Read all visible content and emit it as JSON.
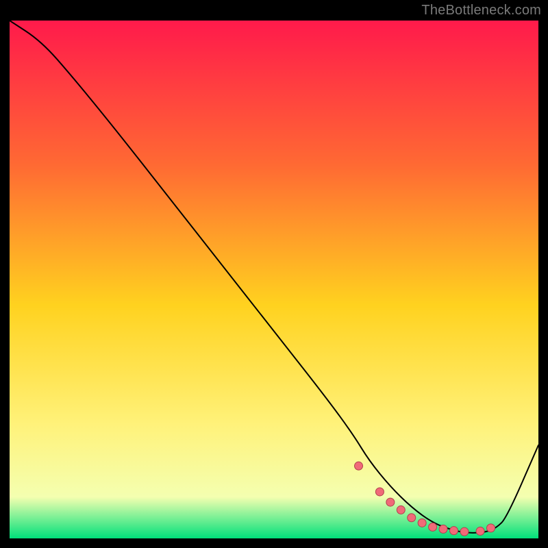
{
  "attribution": "TheBottleneck.com",
  "colors": {
    "bg": "#000000",
    "grad_top": "#ff1a4b",
    "grad_upper": "#ff6a33",
    "grad_mid": "#ffd21f",
    "grad_lower": "#fff27a",
    "grad_pale": "#f4ffb0",
    "grad_bottom": "#00e07a",
    "line": "#000000",
    "marker_fill": "#f06a78",
    "marker_stroke": "#b0404d"
  },
  "chart_data": {
    "type": "line",
    "title": "",
    "xlabel": "",
    "ylabel": "",
    "xlim": [
      0,
      100
    ],
    "ylim": [
      0,
      100
    ],
    "series": [
      {
        "name": "curve",
        "x": [
          0,
          6,
          12,
          20,
          30,
          40,
          50,
          60,
          65,
          68,
          72,
          76,
          80,
          84,
          87,
          90,
          92,
          94,
          100
        ],
        "values": [
          100,
          96,
          89,
          79,
          66,
          53,
          40,
          27,
          20,
          15,
          10,
          6,
          3,
          1.5,
          1,
          1.2,
          2,
          4,
          18
        ]
      }
    ],
    "markers": {
      "name": "flat-region",
      "x": [
        66,
        70,
        72,
        74,
        76,
        78,
        80,
        82,
        84,
        86,
        89,
        91
      ],
      "values": [
        14,
        9,
        7,
        5.5,
        4,
        3,
        2.2,
        1.8,
        1.5,
        1.3,
        1.4,
        2
      ]
    }
  }
}
